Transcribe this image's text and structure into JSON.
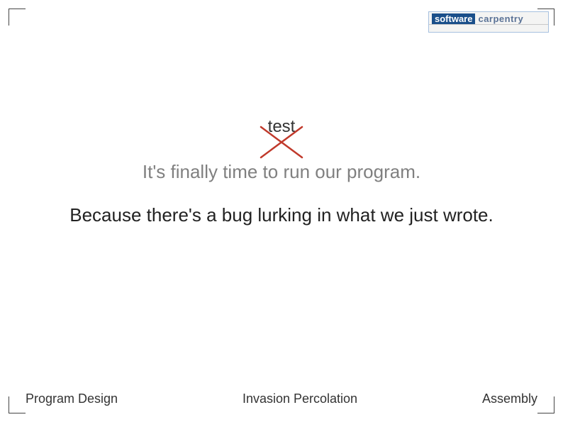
{
  "logo": {
    "word1": "software",
    "word2": "carpentry"
  },
  "content": {
    "annotation_word": "test",
    "line1": "It's finally time to run our program.",
    "line2": "Because there's a bug lurking in what we just wrote.",
    "cross_color": "#c0392b"
  },
  "footer": {
    "left": "Program Design",
    "center": "Invasion Percolation",
    "right": "Assembly"
  }
}
